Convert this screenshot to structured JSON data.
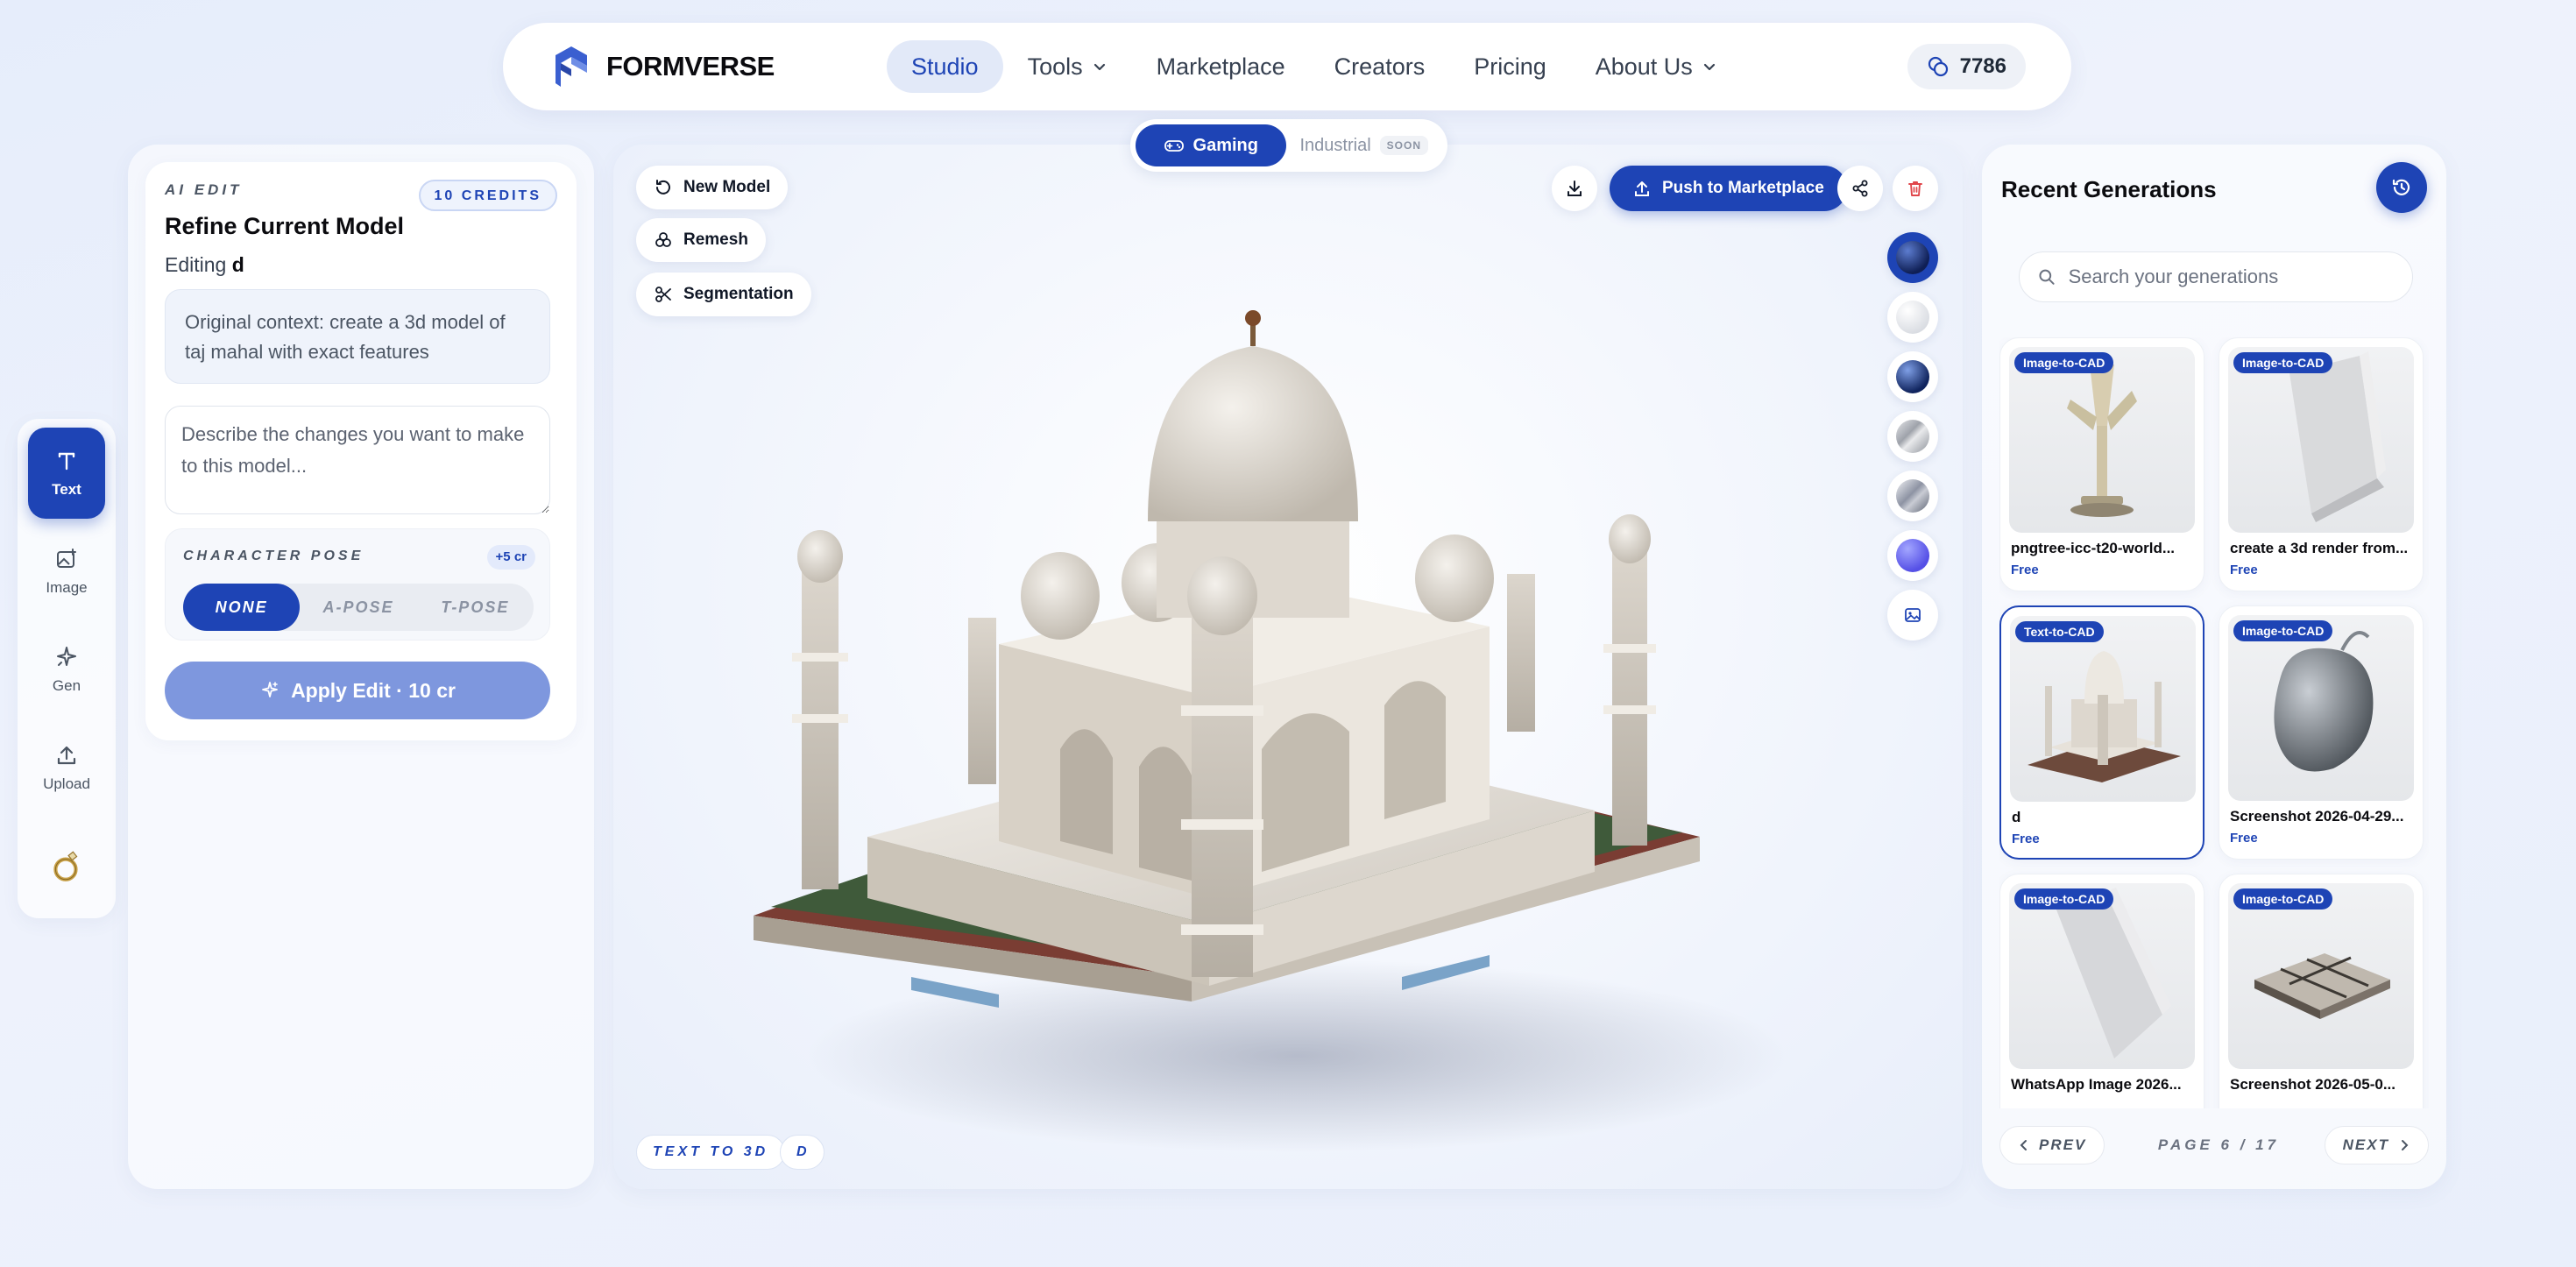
{
  "brand": {
    "name": "FORMVERSE"
  },
  "nav": {
    "items": [
      {
        "label": "Studio",
        "active": true,
        "dropdown": false
      },
      {
        "label": "Tools",
        "active": false,
        "dropdown": true
      },
      {
        "label": "Marketplace",
        "active": false,
        "dropdown": false
      },
      {
        "label": "Creators",
        "active": false,
        "dropdown": false
      },
      {
        "label": "Pricing",
        "active": false,
        "dropdown": false
      },
      {
        "label": "About Us",
        "active": false,
        "dropdown": true
      }
    ],
    "credits": "7786"
  },
  "rail": {
    "items": [
      {
        "label": "Text",
        "icon": "text-icon",
        "active": true
      },
      {
        "label": "Image",
        "icon": "image-icon",
        "active": false
      },
      {
        "label": "Gen",
        "icon": "sparkle-icon",
        "active": false
      },
      {
        "label": "Upload",
        "icon": "upload-icon",
        "active": false
      }
    ]
  },
  "edit_panel": {
    "eyebrow": "AI EDIT",
    "credits_badge": "10 CREDITS",
    "title": "Refine Current Model",
    "editing_prefix": "Editing",
    "editing_name": "d",
    "context": "Original context: create a 3d model of taj mahal with exact features",
    "changes_placeholder": "Describe the changes you want to make to this model...",
    "pose": {
      "label": "CHARACTER POSE",
      "badge": "+5 cr",
      "options": [
        "NONE",
        "A-POSE",
        "T-POSE"
      ],
      "selected": "NONE"
    },
    "apply_label": "Apply Edit · 10 cr"
  },
  "viewport": {
    "mode": {
      "gaming": "Gaming",
      "industrial": "Industrial",
      "soon": "SOON"
    },
    "chips": {
      "new_model": "New Model",
      "remesh": "Remesh",
      "segmentation": "Segmentation"
    },
    "push_label": "Push to Marketplace",
    "bottom": {
      "mode_tag": "TEXT TO 3D",
      "name_tag": "D"
    },
    "materials": [
      "dark-blue",
      "white-matte",
      "blue-gloss",
      "silver-brushed",
      "chrome",
      "purple",
      "image-texture"
    ]
  },
  "recent": {
    "title": "Recent Generations",
    "search_placeholder": "Search your generations",
    "items": [
      {
        "badge": "Image-to-CAD",
        "name": "pngtree-icc-t20-world...",
        "price": "Free",
        "selected": false
      },
      {
        "badge": "Image-to-CAD",
        "name": "create a 3d render from...",
        "price": "Free",
        "selected": false
      },
      {
        "badge": "Text-to-CAD",
        "name": "d",
        "price": "Free",
        "selected": true
      },
      {
        "badge": "Image-to-CAD",
        "name": "Screenshot 2026-04-29...",
        "price": "Free",
        "selected": false
      },
      {
        "badge": "Image-to-CAD",
        "name": "WhatsApp Image 2026...",
        "price": "",
        "selected": false
      },
      {
        "badge": "Image-to-CAD",
        "name": "Screenshot 2026-05-0...",
        "price": "",
        "selected": false
      }
    ],
    "pager": {
      "prev": "PREV",
      "label": "PAGE 6 / 17",
      "next": "NEXT"
    }
  },
  "colors": {
    "primary": "#1e44b5",
    "primary_soft": "#7e97de",
    "danger": "#e0454a"
  }
}
